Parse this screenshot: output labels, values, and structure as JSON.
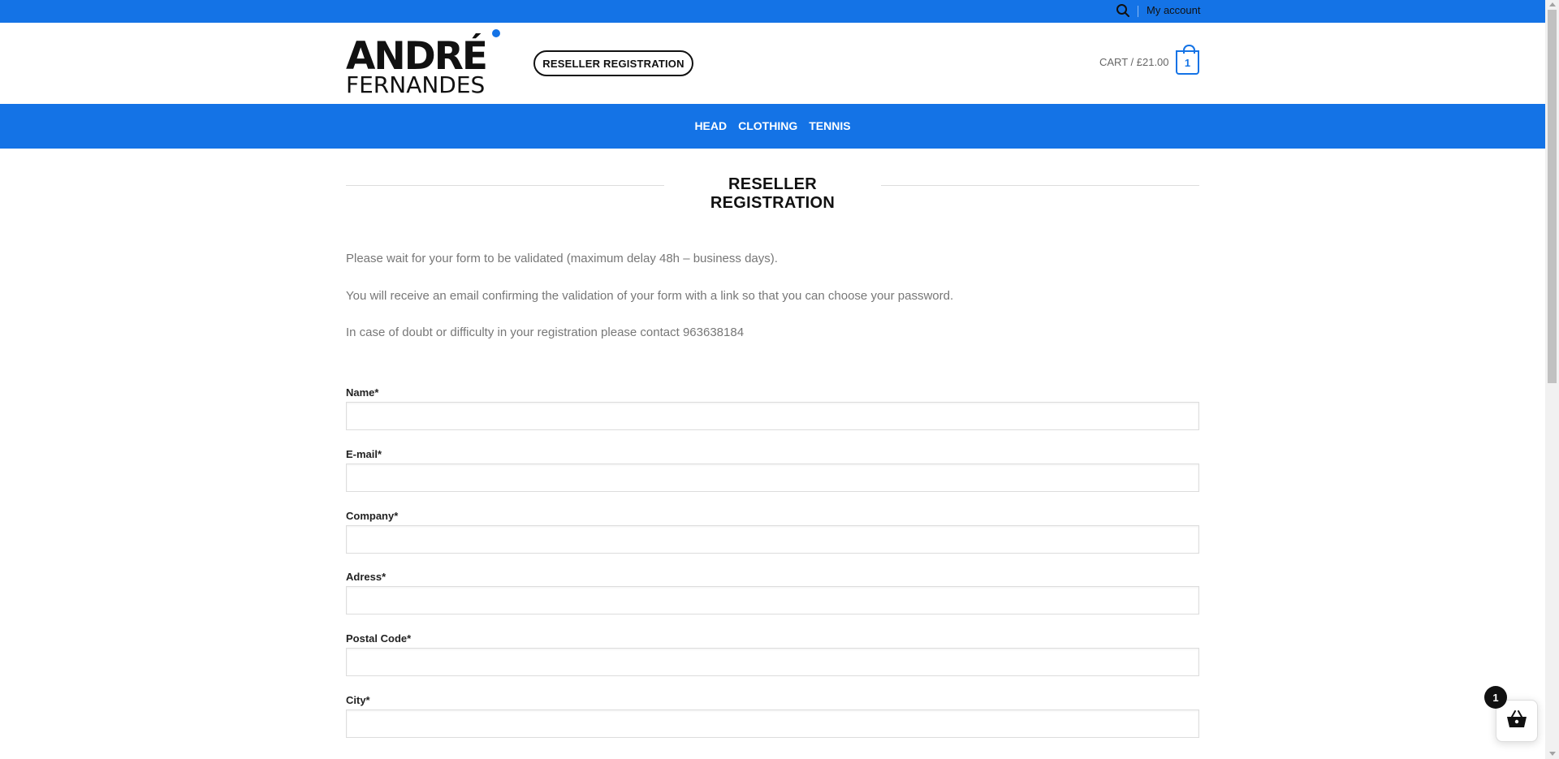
{
  "topbar": {
    "search_icon": "search-icon",
    "account_label": "My account"
  },
  "header": {
    "logo_line1": "ANDRÉ",
    "logo_line2": "FERNANDES",
    "reseller_label": "RESELLER REGISTRATION",
    "cart_label": "CART / £21.00",
    "cart_count": "1"
  },
  "nav": {
    "items": [
      "HEAD",
      "CLOTHING",
      "TENNIS"
    ]
  },
  "page": {
    "title": "RESELLER REGISTRATION",
    "intro": [
      "Please wait for your form to be validated (maximum delay 48h – business days).",
      "You will receive an email confirming the validation of your form with a link so that you can choose your password.",
      "In case of doubt or difficulty in your registration please contact 963638184"
    ]
  },
  "form": {
    "fields": [
      {
        "label": "Name*",
        "value": ""
      },
      {
        "label": "E-mail*",
        "value": ""
      },
      {
        "label": "Company*",
        "value": ""
      },
      {
        "label": "Adress*",
        "value": ""
      },
      {
        "label": "Postal Code*",
        "value": ""
      },
      {
        "label": "City*",
        "value": ""
      }
    ]
  },
  "floating_cart": {
    "count": "1",
    "icon": "basket-icon"
  },
  "colors": {
    "brand": "#1473e6",
    "text_dark": "#111111",
    "text_muted": "#777777"
  }
}
